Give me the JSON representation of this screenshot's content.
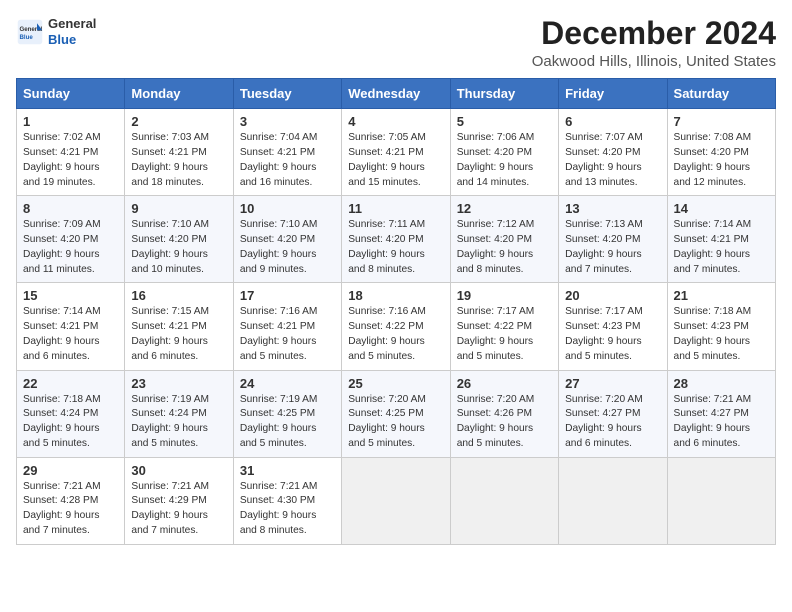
{
  "header": {
    "logo": {
      "general": "General",
      "blue": "Blue"
    },
    "title": "December 2024",
    "subtitle": "Oakwood Hills, Illinois, United States"
  },
  "calendar": {
    "days_of_week": [
      "Sunday",
      "Monday",
      "Tuesday",
      "Wednesday",
      "Thursday",
      "Friday",
      "Saturday"
    ],
    "weeks": [
      [
        {
          "day": "1",
          "sunrise": "7:02 AM",
          "sunset": "4:21 PM",
          "daylight": "9 hours and 19 minutes."
        },
        {
          "day": "2",
          "sunrise": "7:03 AM",
          "sunset": "4:21 PM",
          "daylight": "9 hours and 18 minutes."
        },
        {
          "day": "3",
          "sunrise": "7:04 AM",
          "sunset": "4:21 PM",
          "daylight": "9 hours and 16 minutes."
        },
        {
          "day": "4",
          "sunrise": "7:05 AM",
          "sunset": "4:21 PM",
          "daylight": "9 hours and 15 minutes."
        },
        {
          "day": "5",
          "sunrise": "7:06 AM",
          "sunset": "4:20 PM",
          "daylight": "9 hours and 14 minutes."
        },
        {
          "day": "6",
          "sunrise": "7:07 AM",
          "sunset": "4:20 PM",
          "daylight": "9 hours and 13 minutes."
        },
        {
          "day": "7",
          "sunrise": "7:08 AM",
          "sunset": "4:20 PM",
          "daylight": "9 hours and 12 minutes."
        }
      ],
      [
        {
          "day": "8",
          "sunrise": "7:09 AM",
          "sunset": "4:20 PM",
          "daylight": "9 hours and 11 minutes."
        },
        {
          "day": "9",
          "sunrise": "7:10 AM",
          "sunset": "4:20 PM",
          "daylight": "9 hours and 10 minutes."
        },
        {
          "day": "10",
          "sunrise": "7:10 AM",
          "sunset": "4:20 PM",
          "daylight": "9 hours and 9 minutes."
        },
        {
          "day": "11",
          "sunrise": "7:11 AM",
          "sunset": "4:20 PM",
          "daylight": "9 hours and 8 minutes."
        },
        {
          "day": "12",
          "sunrise": "7:12 AM",
          "sunset": "4:20 PM",
          "daylight": "9 hours and 8 minutes."
        },
        {
          "day": "13",
          "sunrise": "7:13 AM",
          "sunset": "4:20 PM",
          "daylight": "9 hours and 7 minutes."
        },
        {
          "day": "14",
          "sunrise": "7:14 AM",
          "sunset": "4:21 PM",
          "daylight": "9 hours and 7 minutes."
        }
      ],
      [
        {
          "day": "15",
          "sunrise": "7:14 AM",
          "sunset": "4:21 PM",
          "daylight": "9 hours and 6 minutes."
        },
        {
          "day": "16",
          "sunrise": "7:15 AM",
          "sunset": "4:21 PM",
          "daylight": "9 hours and 6 minutes."
        },
        {
          "day": "17",
          "sunrise": "7:16 AM",
          "sunset": "4:21 PM",
          "daylight": "9 hours and 5 minutes."
        },
        {
          "day": "18",
          "sunrise": "7:16 AM",
          "sunset": "4:22 PM",
          "daylight": "9 hours and 5 minutes."
        },
        {
          "day": "19",
          "sunrise": "7:17 AM",
          "sunset": "4:22 PM",
          "daylight": "9 hours and 5 minutes."
        },
        {
          "day": "20",
          "sunrise": "7:17 AM",
          "sunset": "4:23 PM",
          "daylight": "9 hours and 5 minutes."
        },
        {
          "day": "21",
          "sunrise": "7:18 AM",
          "sunset": "4:23 PM",
          "daylight": "9 hours and 5 minutes."
        }
      ],
      [
        {
          "day": "22",
          "sunrise": "7:18 AM",
          "sunset": "4:24 PM",
          "daylight": "9 hours and 5 minutes."
        },
        {
          "day": "23",
          "sunrise": "7:19 AM",
          "sunset": "4:24 PM",
          "daylight": "9 hours and 5 minutes."
        },
        {
          "day": "24",
          "sunrise": "7:19 AM",
          "sunset": "4:25 PM",
          "daylight": "9 hours and 5 minutes."
        },
        {
          "day": "25",
          "sunrise": "7:20 AM",
          "sunset": "4:25 PM",
          "daylight": "9 hours and 5 minutes."
        },
        {
          "day": "26",
          "sunrise": "7:20 AM",
          "sunset": "4:26 PM",
          "daylight": "9 hours and 5 minutes."
        },
        {
          "day": "27",
          "sunrise": "7:20 AM",
          "sunset": "4:27 PM",
          "daylight": "9 hours and 6 minutes."
        },
        {
          "day": "28",
          "sunrise": "7:21 AM",
          "sunset": "4:27 PM",
          "daylight": "9 hours and 6 minutes."
        }
      ],
      [
        {
          "day": "29",
          "sunrise": "7:21 AM",
          "sunset": "4:28 PM",
          "daylight": "9 hours and 7 minutes."
        },
        {
          "day": "30",
          "sunrise": "7:21 AM",
          "sunset": "4:29 PM",
          "daylight": "9 hours and 7 minutes."
        },
        {
          "day": "31",
          "sunrise": "7:21 AM",
          "sunset": "4:30 PM",
          "daylight": "9 hours and 8 minutes."
        },
        null,
        null,
        null,
        null
      ]
    ]
  }
}
